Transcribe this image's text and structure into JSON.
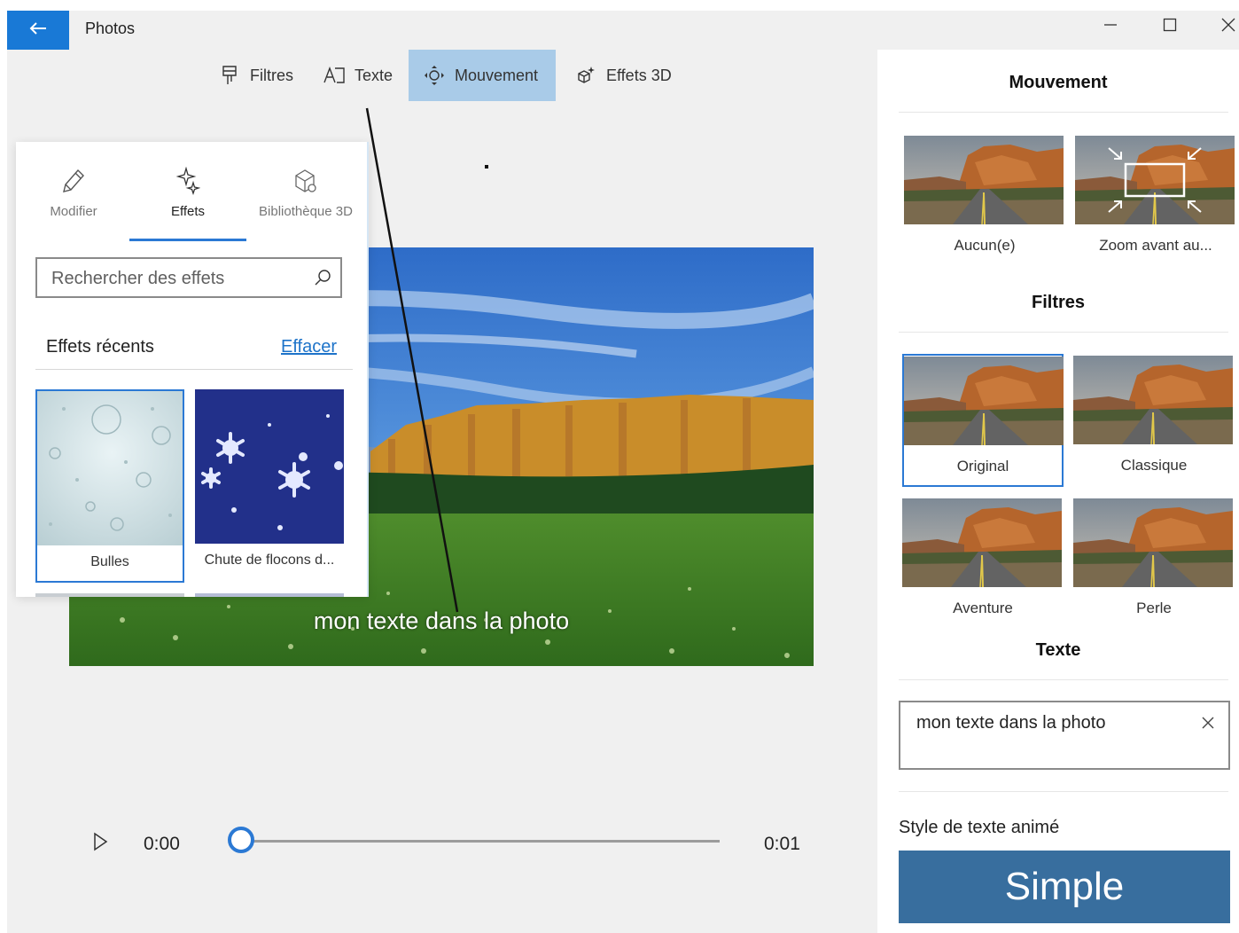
{
  "app": {
    "title": "Photos"
  },
  "toolbar": {
    "items": [
      {
        "label": "Filtres",
        "icon": "filter-icon"
      },
      {
        "label": "Texte",
        "icon": "text-icon"
      },
      {
        "label": "Mouvement",
        "icon": "motion-icon",
        "active": true
      },
      {
        "label": "Effets 3D",
        "icon": "effects-3d-icon"
      }
    ]
  },
  "effects_panel": {
    "tabs": [
      {
        "label": "Modifier",
        "icon": "pencil-icon"
      },
      {
        "label": "Effets",
        "icon": "sparkle-icon",
        "active": true
      },
      {
        "label": "Bibliothèque 3D",
        "icon": "cube-icon"
      }
    ],
    "search_placeholder": "Rechercher des effets",
    "recent_label": "Effets récents",
    "clear_label": "Effacer",
    "effects": [
      {
        "label": "Bulles",
        "selected": true
      },
      {
        "label": "Chute de flocons d..."
      }
    ]
  },
  "preview": {
    "caption": "mon texte dans la photo"
  },
  "side_panel": {
    "motion_heading": "Mouvement",
    "motion_options": [
      {
        "label": "Aucun(e)"
      },
      {
        "label": "Zoom avant au..."
      }
    ],
    "filters_heading": "Filtres",
    "filters": [
      {
        "label": "Original",
        "selected": true
      },
      {
        "label": "Classique"
      },
      {
        "label": "Aventure"
      },
      {
        "label": "Perle"
      }
    ],
    "text_heading": "Texte",
    "text_value": "mon texte dans la photo",
    "style_label": "Style de texte animé",
    "style_value": "Simple"
  },
  "playback": {
    "current_time": "0:00",
    "end_time": "0:01",
    "progress": 0
  },
  "colors": {
    "accent": "#2b79d4",
    "back_button": "#1979d6",
    "active_tab": "#a9cbe8",
    "style_button": "#386e9e"
  }
}
